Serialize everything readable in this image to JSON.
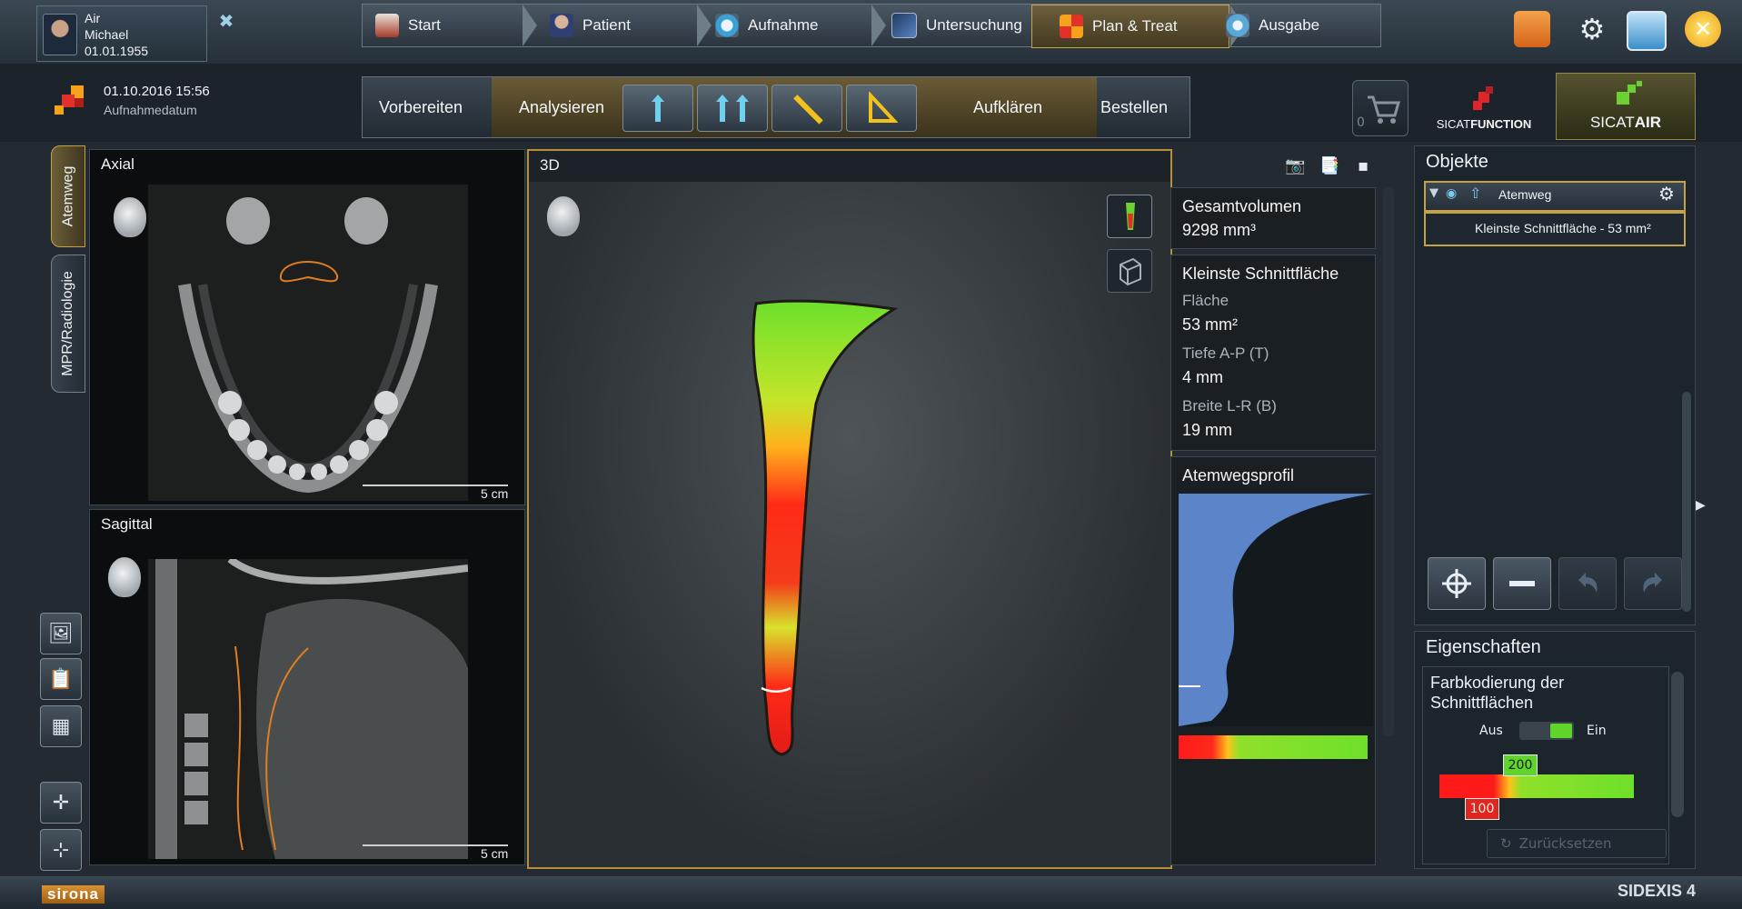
{
  "patient": {
    "line1": "Air",
    "line2": "Michael",
    "line3": "01.01.1955"
  },
  "nav": {
    "tabs": [
      {
        "label": "Start"
      },
      {
        "label": "Patient"
      },
      {
        "label": "Aufnahme"
      },
      {
        "label": "Untersuchung"
      },
      {
        "label": "Plan & Treat"
      },
      {
        "label": "Ausgabe"
      }
    ],
    "active_index": 4
  },
  "acquisition": {
    "datetime": "01.10.2016 15:56",
    "label": "Aufnahmedatum"
  },
  "workflow": {
    "steps": [
      {
        "label": "Vorbereiten"
      },
      {
        "label": "Analysieren"
      },
      {
        "label": "Aufklären"
      },
      {
        "label": "Bestellen"
      }
    ],
    "active_step": "Analysieren",
    "cart_count": "0"
  },
  "apps": {
    "sicat_function": {
      "prefix": "SICAT",
      "suffix": "FUNCTION"
    },
    "sicat_air": {
      "prefix": "SICAT",
      "suffix": "AIR"
    }
  },
  "left_tabs": {
    "atemweg": "Atemweg",
    "mpr": "MPR/Radiologie"
  },
  "views": {
    "axial": {
      "title": "Axial",
      "scale": "5 cm"
    },
    "sagittal": {
      "title": "Sagittal",
      "scale": "5 cm"
    },
    "threeD": {
      "title": "3D"
    }
  },
  "info": {
    "gesamtvolumen_label": "Gesamtvolumen",
    "gesamtvolumen_value": "9298 mm³",
    "kleinste_title": "Kleinste Schnittfläche",
    "flaeche_label": "Fläche",
    "flaeche_value": "53 mm²",
    "tiefe_label": "Tiefe A-P (T)",
    "tiefe_value": "4 mm",
    "breite_label": "Breite L-R (B)",
    "breite_value": "19 mm",
    "profil_title": "Atemwegsprofil"
  },
  "objekte": {
    "title": "Objekte",
    "item": "Atemweg",
    "subitem": "Kleinste Schnittfläche - 53 mm²"
  },
  "eigenschaften": {
    "title": "Eigenschaften",
    "color_label_line1": "Farbkodierung der",
    "color_label_line2": "Schnittflächen",
    "toggle_off": "Aus",
    "toggle_on": "Ein",
    "toggle_state": true,
    "threshold_high": "200",
    "threshold_low": "100",
    "reset_label": "Zurücksetzen"
  },
  "footer": {
    "brand": "sirona",
    "product": "SIDEXIS 4"
  },
  "colors": {
    "accent_gold": "#c6a146",
    "ramp_red": "#ff1a1a",
    "ramp_green": "#6ee02a",
    "profile_blue": "#5b85c8"
  }
}
